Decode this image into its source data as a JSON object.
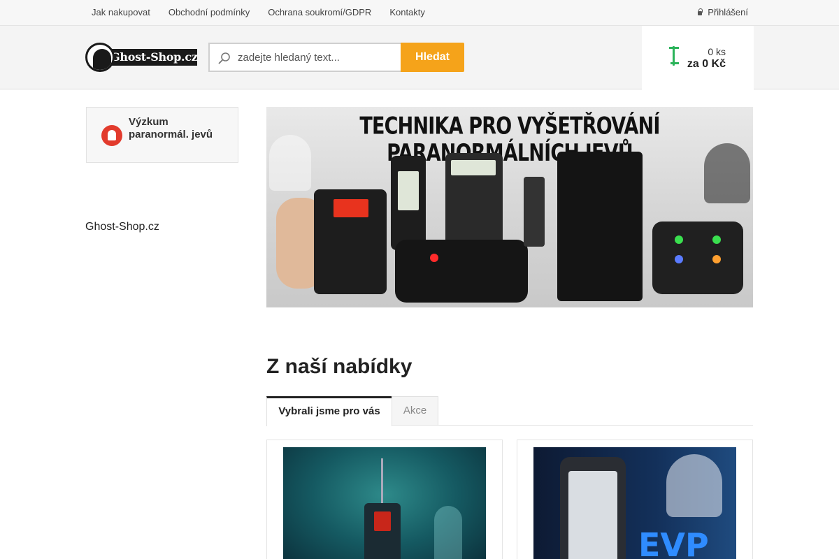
{
  "topnav": {
    "links": [
      "Jak nakupovat",
      "Obchodní podmínky",
      "Ochrana soukromí/GDPR",
      "Kontakty"
    ],
    "login_label": "Přihlášení"
  },
  "header": {
    "logo_text": "Ghost-Shop.cz",
    "search": {
      "placeholder": "zadejte hledaný text...",
      "button_label": "Hledat"
    },
    "cart": {
      "count": "0 ks",
      "total": "za 0 Kč"
    }
  },
  "sidebar": {
    "category_label": "Výzkum paranormál. jevů",
    "brand_text": "Ghost-Shop.cz"
  },
  "banner": {
    "title": "TECHNIKA PRO VYŠETŘOVÁNÍ PARANORMÁLNÍCH JEVŮ"
  },
  "offers": {
    "title": "Z naší nabídky",
    "tabs": [
      "Vybrali jsme pro vás",
      "Akce"
    ]
  },
  "colors": {
    "accent": "#f5a31a",
    "cart_green": "#2bb35a",
    "category_red": "#e23b2d"
  }
}
